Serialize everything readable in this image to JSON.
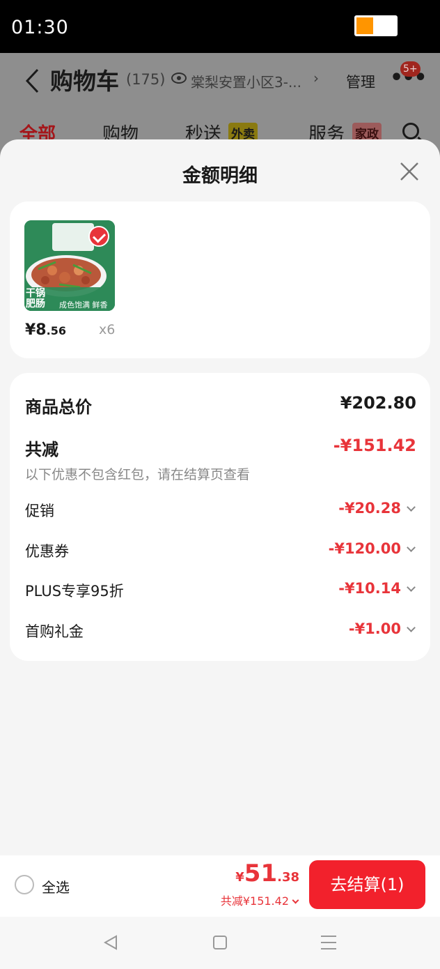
{
  "status_bar": {
    "time": "01:30"
  },
  "background_page": {
    "title": "购物车",
    "count": "(175)",
    "address": "棠梨安置小区3-...",
    "manage_label": "管理",
    "message_badge": "5+",
    "tabs": [
      {
        "label": "全部",
        "active": true
      },
      {
        "label": "购物"
      },
      {
        "label": "秒送",
        "tag": "外卖"
      },
      {
        "label": "服务",
        "tag": "家政"
      }
    ]
  },
  "sheet": {
    "title": "金额明细",
    "product": {
      "image_text_main": "干锅肥肠",
      "image_text_sub": "成色饱满 鲜香入味",
      "price_yen": "¥8",
      "price_decimal": ".56",
      "quantity": "x6"
    },
    "summary": {
      "total_label": "商品总价",
      "total_value": "¥202.80",
      "reduction_label": "共减",
      "reduction_value": "-¥151.42",
      "note": "以下优惠不包含红包，请在结算页查看",
      "details": [
        {
          "label": "促销",
          "value": "-¥20.28"
        },
        {
          "label": "优惠券",
          "value": "-¥120.00"
        },
        {
          "label": "PLUS专享95折",
          "value": "-¥10.14"
        },
        {
          "label": "首购礼金",
          "value": "-¥1.00"
        }
      ]
    }
  },
  "bottom_bar": {
    "select_all_label": "全选",
    "price_yen": "¥",
    "price_int": "51",
    "price_dec": ".38",
    "saved_text": "共减¥151.42",
    "checkout_label": "去结算(1)"
  },
  "colors": {
    "accent_red": "#e8343a",
    "checkout_button": "#f2212c",
    "battery": "#ff9500"
  }
}
